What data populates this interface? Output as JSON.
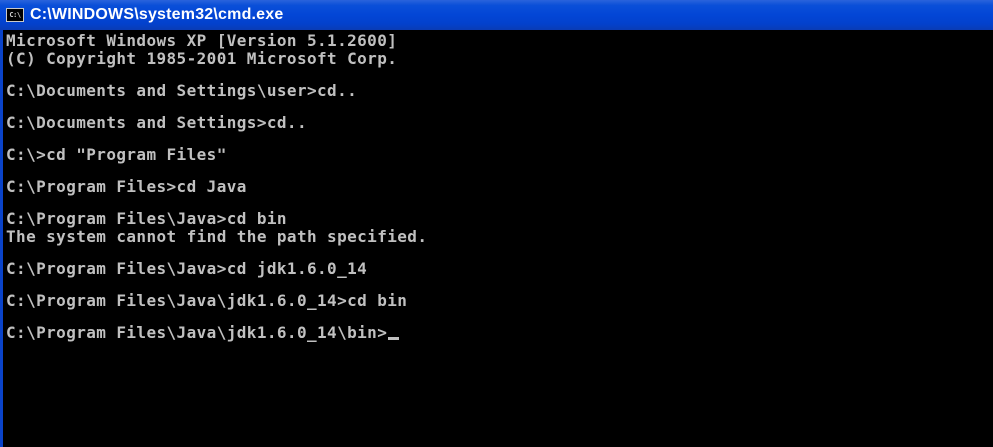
{
  "window": {
    "title": "C:\\WINDOWS\\system32\\cmd.exe",
    "icon": "cmd-icon",
    "icon_text": "C:\\"
  },
  "console": {
    "lines": [
      "Microsoft Windows XP [Version 5.1.2600]",
      "(C) Copyright 1985-2001 Microsoft Corp.",
      "",
      "C:\\Documents and Settings\\user>cd..",
      "",
      "C:\\Documents and Settings>cd..",
      "",
      "C:\\>cd \"Program Files\"",
      "",
      "C:\\Program Files>cd Java",
      "",
      "C:\\Program Files\\Java>cd bin",
      "The system cannot find the path specified.",
      "",
      "C:\\Program Files\\Java>cd jdk1.6.0_14",
      "",
      "C:\\Program Files\\Java\\jdk1.6.0_14>cd bin",
      "",
      "C:\\Program Files\\Java\\jdk1.6.0_14\\bin>"
    ]
  },
  "colors": {
    "title_bar": "#0346d6",
    "console_bg": "#000000",
    "console_text": "#c0c0c0"
  }
}
